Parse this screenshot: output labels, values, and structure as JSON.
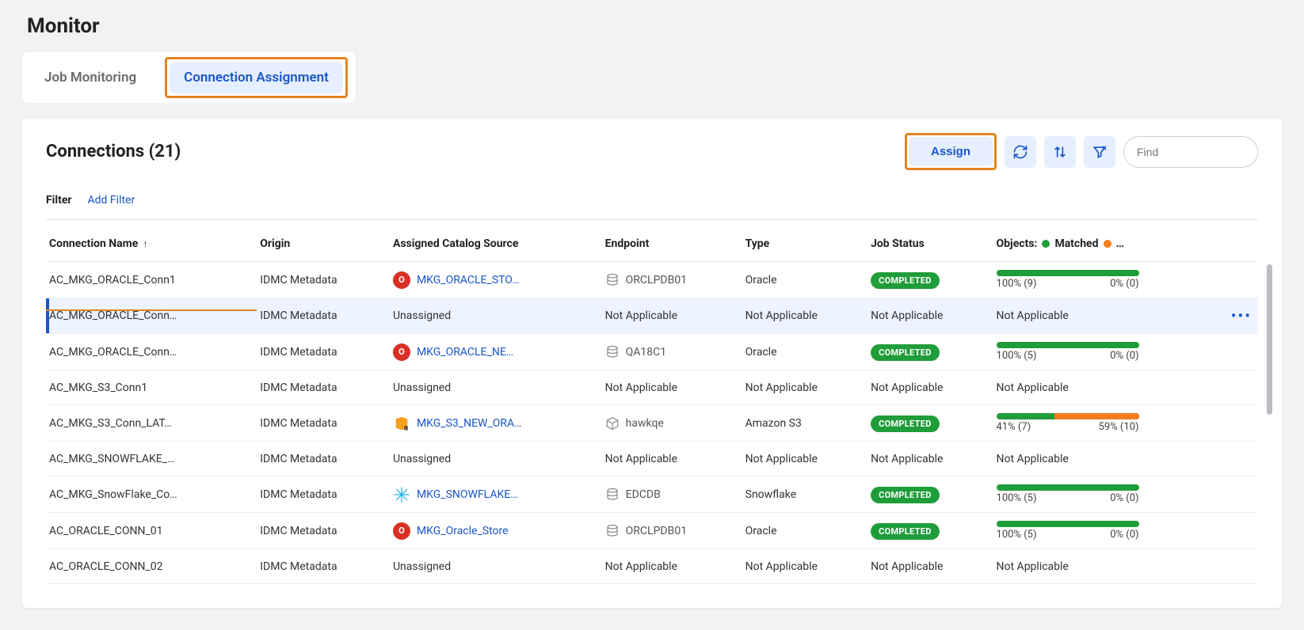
{
  "page_title": "Monitor",
  "tabs": {
    "job_monitoring": "Job Monitoring",
    "connection_assignment": "Connection Assignment"
  },
  "panel": {
    "title": "Connections (21)",
    "assign_label": "Assign",
    "find_placeholder": "Find",
    "filter_label": "Filter",
    "add_filter_label": "Add Filter"
  },
  "columns": {
    "connection_name": "Connection Name",
    "origin": "Origin",
    "assigned_catalog_source": "Assigned Catalog Source",
    "endpoint": "Endpoint",
    "type": "Type",
    "job_status": "Job Status",
    "objects_label": "Objects:",
    "matched_label": "Matched",
    "truncated": "…"
  },
  "status_labels": {
    "completed": "COMPLETED"
  },
  "rows": [
    {
      "name": "AC_MKG_ORACLE_Conn1",
      "origin": "IDMC Metadata",
      "source": "MKG_ORACLE_STO…",
      "source_kind": "oracle",
      "endpoint": "ORCLPDB01",
      "type": "Oracle",
      "job_status": "COMPLETED",
      "objects": {
        "matched_pct": 100,
        "matched_n": 9,
        "unmatched_pct": 0,
        "unmatched_n": 0
      }
    },
    {
      "name": "AC_MKG_ORACLE_Conn…",
      "origin": "IDMC Metadata",
      "source": "Unassigned",
      "source_kind": "unassigned",
      "endpoint": "Not Applicable",
      "type": "Not Applicable",
      "job_status": "Not Applicable",
      "objects_text": "Not Applicable",
      "selected": true
    },
    {
      "name": "AC_MKG_ORACLE_Conn…",
      "origin": "IDMC Metadata",
      "source": "MKG_ORACLE_NE…",
      "source_kind": "oracle",
      "endpoint": "QA18C1",
      "type": "Oracle",
      "job_status": "COMPLETED",
      "objects": {
        "matched_pct": 100,
        "matched_n": 5,
        "unmatched_pct": 0,
        "unmatched_n": 0
      }
    },
    {
      "name": "AC_MKG_S3_Conn1",
      "origin": "IDMC Metadata",
      "source": "Unassigned",
      "source_kind": "unassigned",
      "endpoint": "Not Applicable",
      "type": "Not Applicable",
      "job_status": "Not Applicable",
      "objects_text": "Not Applicable"
    },
    {
      "name": "AC_MKG_S3_Conn_LAT…",
      "origin": "IDMC Metadata",
      "source": "MKG_S3_NEW_ORA…",
      "source_kind": "s3",
      "endpoint": "hawkqe",
      "endpoint_icon": "cube",
      "type": "Amazon S3",
      "job_status": "COMPLETED",
      "objects": {
        "matched_pct": 41,
        "matched_n": 7,
        "unmatched_pct": 59,
        "unmatched_n": 10
      }
    },
    {
      "name": "AC_MKG_SNOWFLAKE_…",
      "origin": "IDMC Metadata",
      "source": "Unassigned",
      "source_kind": "unassigned",
      "endpoint": "Not Applicable",
      "type": "Not Applicable",
      "job_status": "Not Applicable",
      "objects_text": "Not Applicable"
    },
    {
      "name": "AC_MKG_SnowFlake_Co…",
      "origin": "IDMC Metadata",
      "source": "MKG_SNOWFLAKE…",
      "source_kind": "snowflake",
      "endpoint": "EDCDB",
      "type": "Snowflake",
      "job_status": "COMPLETED",
      "objects": {
        "matched_pct": 100,
        "matched_n": 5,
        "unmatched_pct": 0,
        "unmatched_n": 0
      }
    },
    {
      "name": "AC_ORACLE_CONN_01",
      "origin": "IDMC Metadata",
      "source": "MKG_Oracle_Store",
      "source_kind": "oracle",
      "endpoint": "ORCLPDB01",
      "type": "Oracle",
      "job_status": "COMPLETED",
      "objects": {
        "matched_pct": 100,
        "matched_n": 5,
        "unmatched_pct": 0,
        "unmatched_n": 0
      }
    },
    {
      "name": "AC_ORACLE_CONN_02",
      "origin": "IDMC Metadata",
      "source": "Unassigned",
      "source_kind": "unassigned",
      "endpoint": "Not Applicable",
      "type": "Not Applicable",
      "job_status": "Not Applicable",
      "objects_text": "Not Applicable"
    }
  ]
}
